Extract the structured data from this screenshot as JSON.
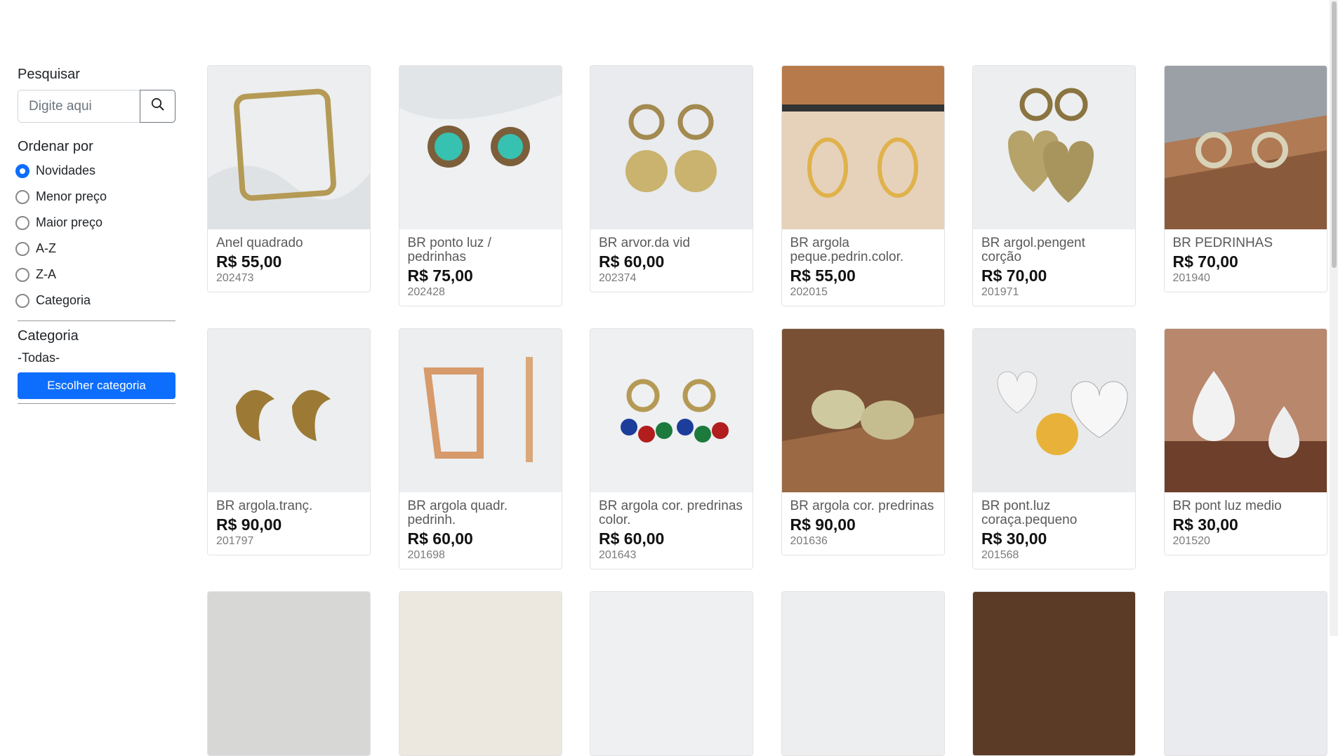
{
  "sidebar": {
    "search_label": "Pesquisar",
    "search_placeholder": "Digite aqui",
    "search_icon": "search-icon",
    "sort_label": "Ordenar por",
    "sort_options": [
      "Novidades",
      "Menor preço",
      "Maior preço",
      "A-Z",
      "Z-A",
      "Categoria"
    ],
    "sort_selected": "Novidades",
    "category_label": "Categoria",
    "category_value": "-Todas-",
    "category_button": "Escolher categoria"
  },
  "products": [
    {
      "name": "Anel quadrado",
      "price": "R$ 55,00",
      "code": "202473",
      "image": "square-ring-photo"
    },
    {
      "name": "BR ponto luz / pedrinhas",
      "price": "R$ 75,00",
      "code": "202428",
      "image": "turquoise-stud-earrings-photo"
    },
    {
      "name": "BR arvor.da vid",
      "price": "R$ 60,00",
      "code": "202374",
      "image": "tree-of-life-earrings-photo"
    },
    {
      "name": "BR argola peque.pedrin.color.",
      "price": "R$ 55,00",
      "code": "202015",
      "image": "small-hoop-colored-stones-photo"
    },
    {
      "name": "BR argol.pengent corção",
      "price": "R$ 70,00",
      "code": "201971",
      "image": "heart-pendant-hoops-photo"
    },
    {
      "name": "BR PEDRINHAS",
      "price": "R$ 70,00",
      "code": "201940",
      "image": "cc-stone-earrings-photo"
    },
    {
      "name": "BR argola.tranç.",
      "price": "R$ 90,00",
      "code": "201797",
      "image": "braided-hoop-photo"
    },
    {
      "name": "BR argola quadr. pedrinh.",
      "price": "R$ 60,00",
      "code": "201698",
      "image": "square-hoop-stones-photo"
    },
    {
      "name": "BR argola cor. predrinas color.",
      "price": "R$ 60,00",
      "code": "201643",
      "image": "colored-drop-hoops-photo"
    },
    {
      "name": "BR argola cor. predrinas",
      "price": "R$ 90,00",
      "code": "201636",
      "image": "pave-hoops-photo"
    },
    {
      "name": "BR pont.luz coraça.pequeno",
      "price": "R$ 30,00",
      "code": "201568",
      "image": "heart-crystal-stud-photo"
    },
    {
      "name": "BR pont luz medio",
      "price": "R$ 30,00",
      "code": "201520",
      "image": "pear-crystal-stud-photo"
    }
  ],
  "colors": {
    "accent": "#0d6efd",
    "text": "#212529",
    "muted": "#6c757d"
  }
}
